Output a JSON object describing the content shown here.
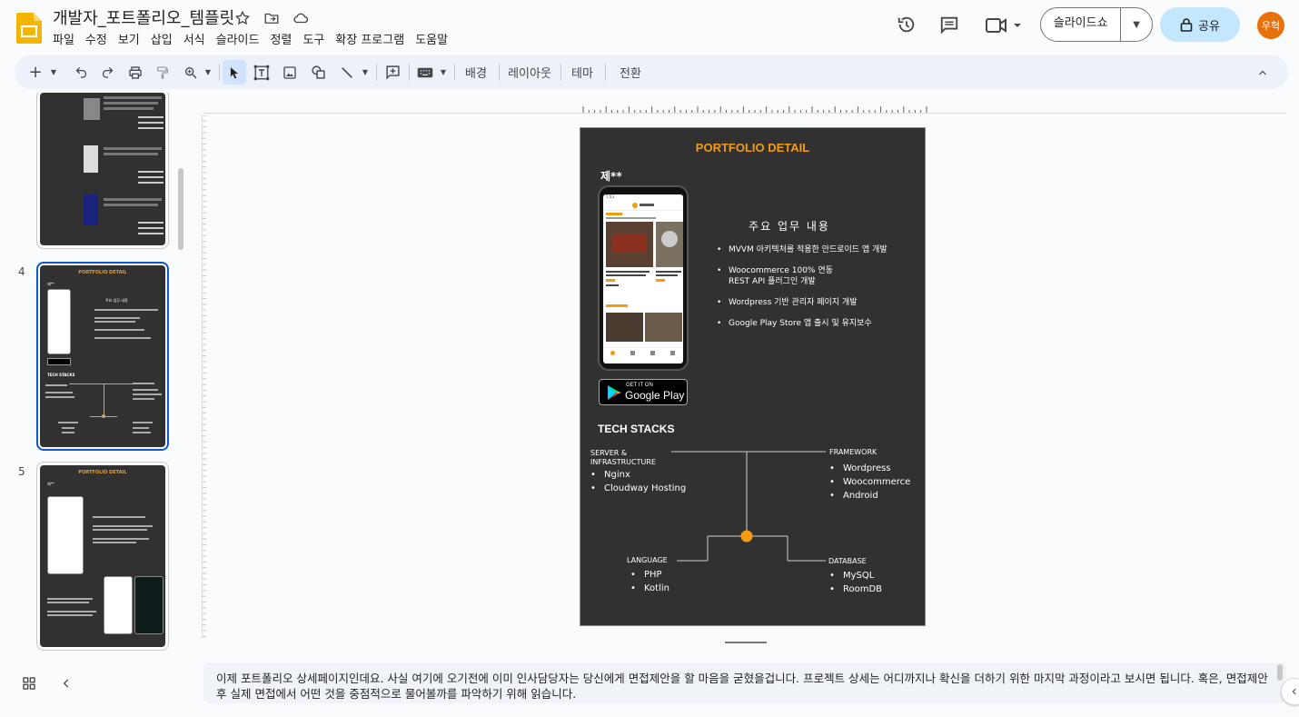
{
  "doc": {
    "title": "개발자_포트폴리오_템플릿",
    "menus": [
      "파일",
      "수정",
      "보기",
      "삽입",
      "서식",
      "슬라이드",
      "정렬",
      "도구",
      "확장 프로그램",
      "도움말"
    ]
  },
  "header": {
    "slideshow_label": "슬라이드쇼",
    "share_label": "공유",
    "avatar_initials": "우혁"
  },
  "toolbar": {
    "background_label": "배경",
    "layout_label": "레이아웃",
    "theme_label": "테마",
    "transition_label": "전환"
  },
  "filmstrip": {
    "slide_numbers": [
      "4",
      "5"
    ],
    "selected_slide": "4"
  },
  "slide": {
    "title": "PORTFOLIO DETAIL",
    "project_name": "제**",
    "tasks_title": "주요 업무 내용",
    "tasks": [
      "MVVM 아키텍처를 적용한 안드로이드 앱 개발",
      "Woocommerce 100% 연동\nREST API 플러그인 개발",
      "Wordpress 기반 관리자 페이지 개발",
      "Google Play Store 앱 출시 및 유지보수"
    ],
    "google_play": {
      "line1": "GET IT ON",
      "line2": "Google Play"
    },
    "tech_title": "TECH STACKS",
    "stacks": {
      "server": {
        "label": "SERVER &\nINFRASTRUCTURE",
        "items": [
          "Nginx",
          "Cloudway Hosting"
        ]
      },
      "framework": {
        "label": "FRAMEWORK",
        "items": [
          "Wordpress",
          "Woocommerce",
          "Android"
        ]
      },
      "language": {
        "label": "LANGUAGE",
        "items": [
          "PHP",
          "Kotlin"
        ]
      },
      "database": {
        "label": "DATABASE",
        "items": [
          "MySQL",
          "RoomDB"
        ]
      }
    },
    "accent_color": "#f39c12"
  },
  "notes": {
    "text": "이제 포트폴리오 상세페이지인데요. 사실 여기에 오기전에 이미 인사담당자는 당신에게 면접제안을 할 마음을 굳혔을겁니다. 프로젝트 상세는 어디까지나 확신을 더하기 위한 마지막 과정이라고 보시면 됩니다. 혹은, 면접제안 후 실제 면접에서 어떤 것을 중점적으로 물어볼까를 파악하기 위해 읽습니다."
  }
}
